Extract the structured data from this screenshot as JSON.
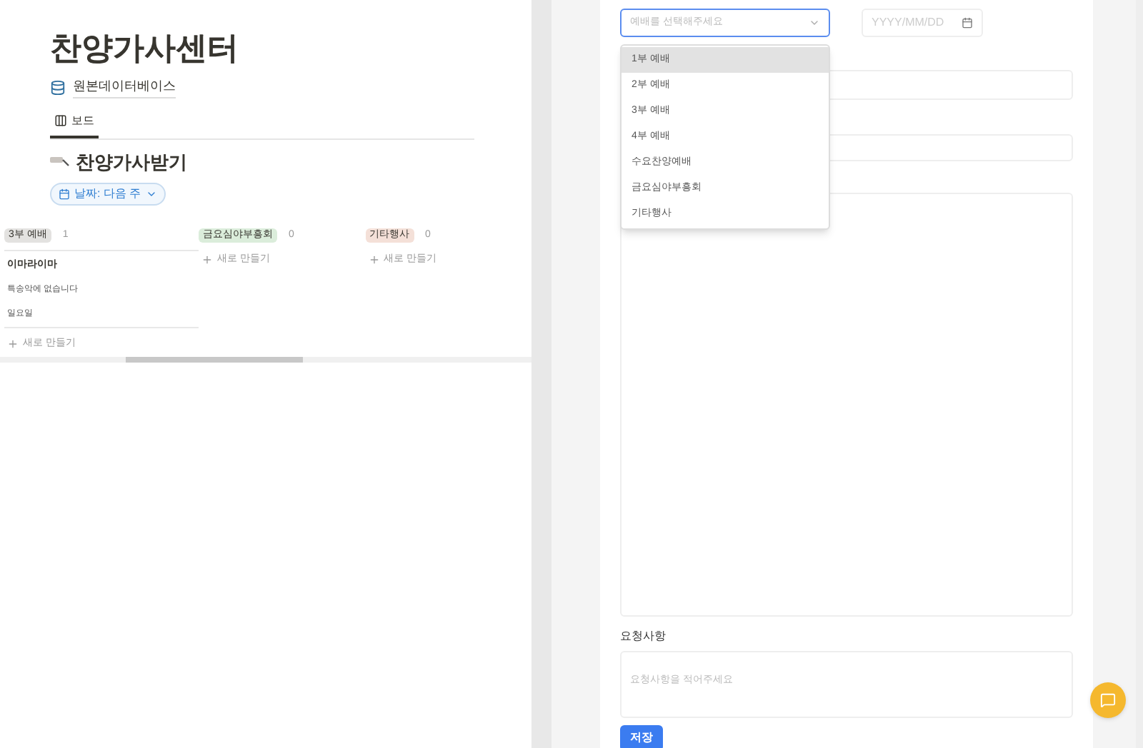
{
  "board": {
    "title": "찬양가사센터",
    "database_link": "원본데이터베이스",
    "tabs": [
      {
        "label": "보드",
        "selected": true
      }
    ],
    "view_title": "찬양가사받기",
    "filter": "날짜: 다음 주",
    "columns": [
      {
        "label": "3부 예배",
        "count": "1",
        "color": "#e3e2e0",
        "cards": [
          {
            "title": "이마라이마",
            "properties": [
              "특송악에 없습니다",
              "일요일"
            ]
          }
        ],
        "new_label": "새로 만들기"
      },
      {
        "label": "금요심야부흥회",
        "count": "0",
        "color": "#dbeddb",
        "new_label": "새로 만들기"
      },
      {
        "label": "기타행사",
        "count": "0",
        "color": "#f4e0d8",
        "new_label": "새로 만들기"
      }
    ]
  },
  "form": {
    "service_select": {
      "placeholder": "예배를 선택해주세요",
      "expanded": true,
      "options": [
        {
          "label": "1부 예배",
          "selected": true
        },
        {
          "label": "2부 예배",
          "selected": false
        },
        {
          "label": "3부 예배",
          "selected": false
        },
        {
          "label": "4부 예배",
          "selected": false
        },
        {
          "label": "수요찬양예배",
          "selected": false
        },
        {
          "label": "금요심야부흥회",
          "selected": false
        },
        {
          "label": "기타행사",
          "selected": false
        }
      ]
    },
    "date_field": {
      "placeholder": "YYYY/MM/DD"
    },
    "request_label": "요청사항",
    "request_field": {
      "placeholder": "요청사항을 적어주세요"
    },
    "save_button": "저장"
  }
}
